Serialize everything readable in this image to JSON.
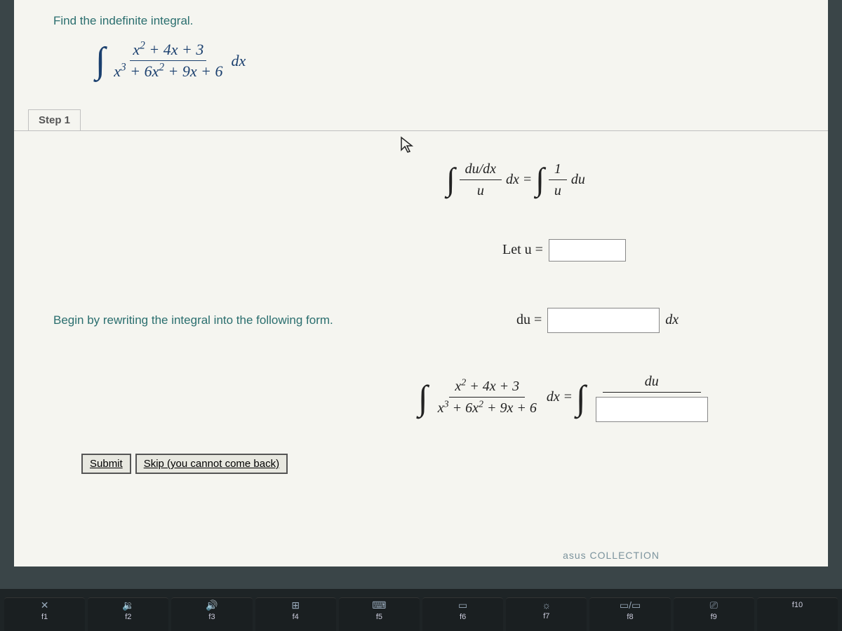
{
  "problem": {
    "title": "Find the indefinite integral.",
    "integral_numerator": "x² + 4x + 3",
    "integral_denominator": "x³ + 6x² + 9x + 6",
    "dx": "dx"
  },
  "step": {
    "label": "Step 1",
    "instruction": "Begin by rewriting the integral into the following form.",
    "identity_left_num": "du/dx",
    "identity_left_den": "u",
    "identity_dx": "dx",
    "identity_eq": "=",
    "identity_right_num": "1",
    "identity_right_den": "u",
    "identity_du": "du",
    "let_u": "Let u =",
    "du_eq": "du =",
    "dx_trail": "dx",
    "main_num": "x² + 4x + 3",
    "main_den": "x³ + 6x² + 9x + 6",
    "main_dx": "dx",
    "main_eq": "=",
    "frac_num": "du"
  },
  "buttons": {
    "submit": "Submit",
    "skip": "Skip (you cannot come back)"
  },
  "footer_tag": "asus COLLECTION",
  "keyboard": {
    "keys": [
      {
        "label": "f1",
        "icon": "✕"
      },
      {
        "label": "f2",
        "icon": "🔉"
      },
      {
        "label": "f3",
        "icon": "🔊"
      },
      {
        "label": "f4",
        "icon": "⊞"
      },
      {
        "label": "f5",
        "icon": "⌨"
      },
      {
        "label": "f6",
        "icon": "▭"
      },
      {
        "label": "f7",
        "icon": "☼"
      },
      {
        "label": "f8",
        "icon": "▭/▭"
      },
      {
        "label": "f9",
        "icon": "⎚"
      },
      {
        "label": "f10",
        "icon": ""
      }
    ]
  }
}
